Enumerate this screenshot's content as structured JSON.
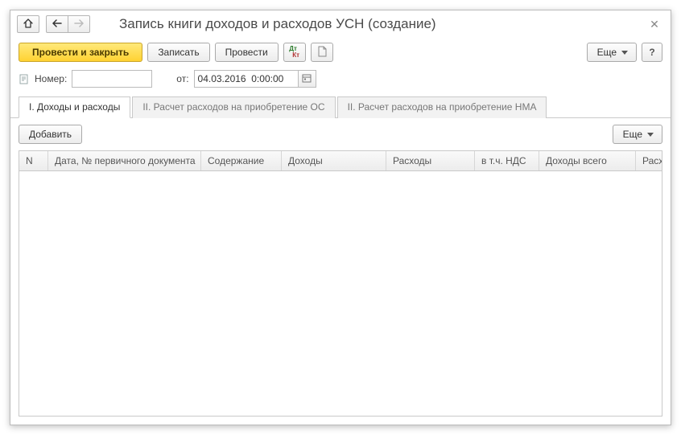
{
  "header": {
    "title": "Запись книги доходов и расходов УСН (создание)"
  },
  "toolbar": {
    "post_and_close": "Провести и закрыть",
    "save": "Записать",
    "post": "Провести",
    "more": "Еще",
    "help": "?"
  },
  "fields": {
    "number_label": "Номер:",
    "number_value": "",
    "date_label": "от:",
    "date_value": "04.03.2016  0:00:00"
  },
  "tabs": [
    {
      "label": "I. Доходы и расходы",
      "active": true
    },
    {
      "label": "II. Расчет расходов на приобретение ОС",
      "active": false
    },
    {
      "label": "II. Расчет расходов на приобретение НМА",
      "active": false
    }
  ],
  "inner_toolbar": {
    "add": "Добавить",
    "more": "Еще"
  },
  "grid": {
    "columns": {
      "n": "N",
      "date_doc": "Дата, № первичного документа",
      "content": "Содержание",
      "income": "Доходы",
      "expense": "Расходы",
      "incl_vat": "в т.ч. НДС",
      "income_total": "Доходы всего",
      "expense_total": "Расхо"
    },
    "rows": []
  }
}
